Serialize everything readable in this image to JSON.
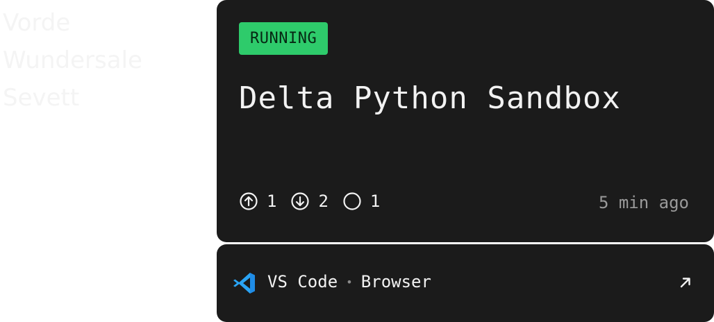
{
  "background_text": "Vorde\nWundersale\nSevett",
  "card": {
    "status": "RUNNING",
    "title": "Delta Python Sandbox",
    "stats": [
      {
        "icon": "arrow-up-circle-icon",
        "value": "1"
      },
      {
        "icon": "arrow-down-circle-icon",
        "value": "2"
      },
      {
        "icon": "circle-icon",
        "value": "1"
      }
    ],
    "age": "5 min ago"
  },
  "footer": {
    "icon": "vscode-icon",
    "tools": [
      "VS Code",
      "Browser"
    ],
    "separator": "•",
    "link_icon": "arrow-up-right-icon"
  },
  "colors": {
    "card_bg": "#1b1b1b",
    "status_green": "#2ecb6b",
    "vscode_blue": "#1f8ce6",
    "muted_text": "#9a9a9a"
  }
}
